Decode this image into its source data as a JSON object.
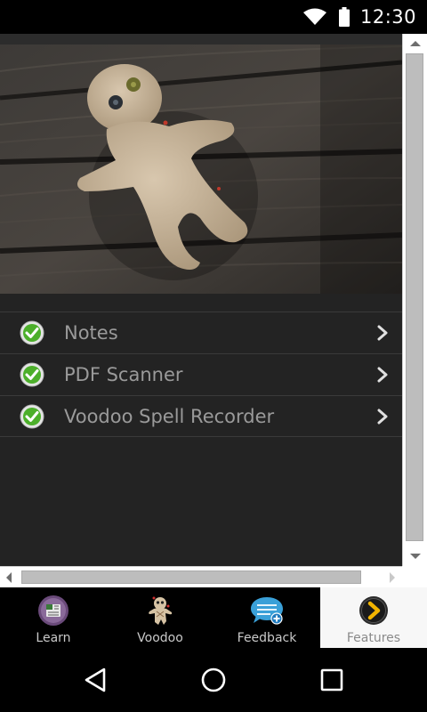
{
  "status_bar": {
    "time": "12:30",
    "icons": [
      "wifi-icon",
      "battery-icon"
    ]
  },
  "hero": {
    "image": "voodoo-doll-on-wooden-planks"
  },
  "menu": {
    "items": [
      {
        "label": "Notes",
        "icon": "green-check-icon"
      },
      {
        "label": "PDF Scanner",
        "icon": "green-check-icon"
      },
      {
        "label": "Voodoo Spell Recorder",
        "icon": "green-check-icon"
      }
    ]
  },
  "tabs": [
    {
      "label": "Learn",
      "icon": "learn-book-icon",
      "active": false
    },
    {
      "label": "Voodoo",
      "icon": "voodoo-doll-icon",
      "active": false
    },
    {
      "label": "Feedback",
      "icon": "feedback-bubble-icon",
      "active": false
    },
    {
      "label": "Features",
      "icon": "features-arrow-icon",
      "active": true
    }
  ],
  "navigation": {
    "buttons": [
      "back-icon",
      "home-icon",
      "recents-icon"
    ]
  },
  "colors": {
    "check_green": "#4caf2a",
    "active_tab_bg": "#f7f7f7",
    "list_text": "#9a9a9a"
  }
}
